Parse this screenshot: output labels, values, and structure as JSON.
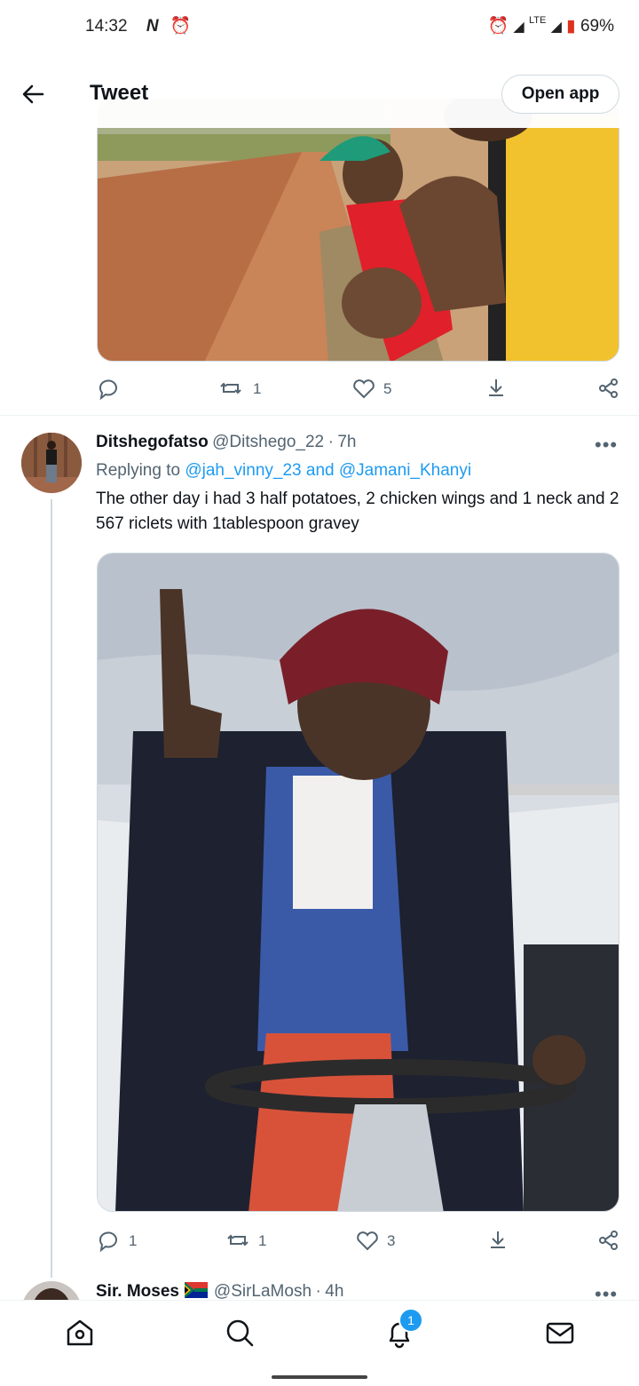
{
  "status_bar": {
    "time": "14:32",
    "battery": "69%",
    "network": "LTE"
  },
  "header": {
    "title": "Tweet",
    "open_app_label": "Open app"
  },
  "prev_tweet": {
    "actions": {
      "replies": "",
      "retweets": "1",
      "likes": "5"
    }
  },
  "reply": {
    "name": "Ditshegofatso",
    "handle": "@Ditshego_22",
    "separator": "·",
    "time": "7h",
    "replying_prefix": "Replying to ",
    "replying_user_1": "@jah_vinny_23",
    "replying_and": " and ",
    "replying_user_2": "@Jamani_Khanyi",
    "text": "The other day i had 3 half potatoes, 2 chicken wings and 1 neck and 2 567 riclets with 1tablespoon gravey",
    "actions": {
      "replies": "1",
      "retweets": "1",
      "likes": "3"
    }
  },
  "next_tweet": {
    "name": "Sir. Moses",
    "handle": "@SirLaMosh",
    "separator": "·",
    "time": "4h"
  },
  "bottom_nav": {
    "notifications_badge": "1"
  },
  "colors": {
    "accent": "#1d9bf0",
    "text": "#0f1419",
    "muted": "#536471"
  }
}
